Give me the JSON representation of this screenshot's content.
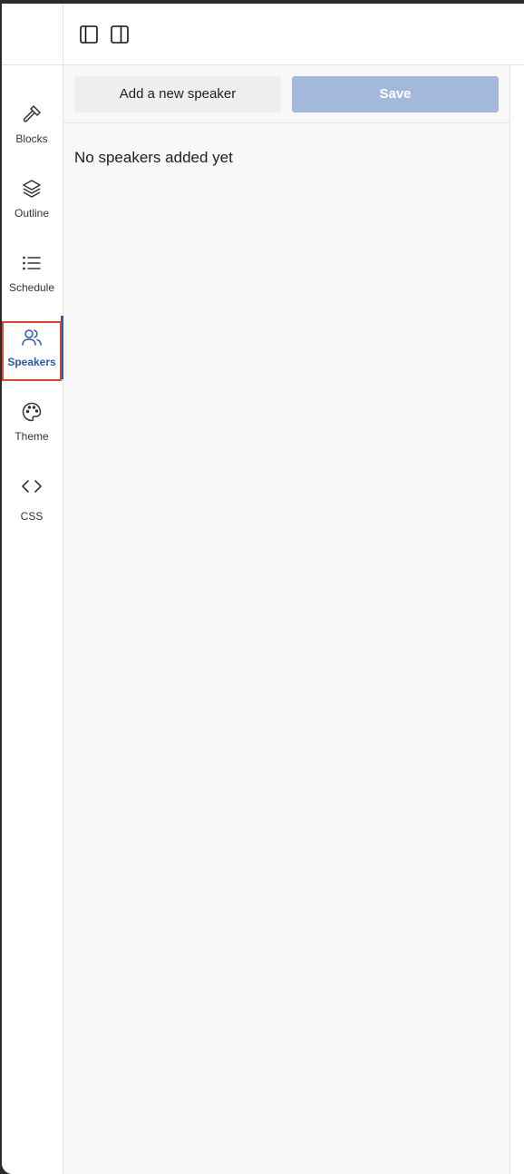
{
  "rail": {
    "items": [
      {
        "label": "Blocks",
        "icon": "hammer-icon"
      },
      {
        "label": "Outline",
        "icon": "layers-icon"
      },
      {
        "label": "Schedule",
        "icon": "list-icon"
      },
      {
        "label": "Speakers",
        "icon": "users-icon",
        "active": true
      },
      {
        "label": "Theme",
        "icon": "palette-icon"
      },
      {
        "label": "CSS",
        "icon": "code-icon"
      }
    ]
  },
  "header": {
    "left_toggle_icon": "sidebar-left-icon",
    "right_toggle_icon": "sidebar-right-icon"
  },
  "panel": {
    "add_button_label": "Add a new speaker",
    "save_button_label": "Save",
    "empty_message": "No speakers added yet"
  },
  "colors": {
    "accent": "#2d5aa6",
    "save_disabled": "#a4b8dc",
    "focus_ring": "#d9482b"
  }
}
